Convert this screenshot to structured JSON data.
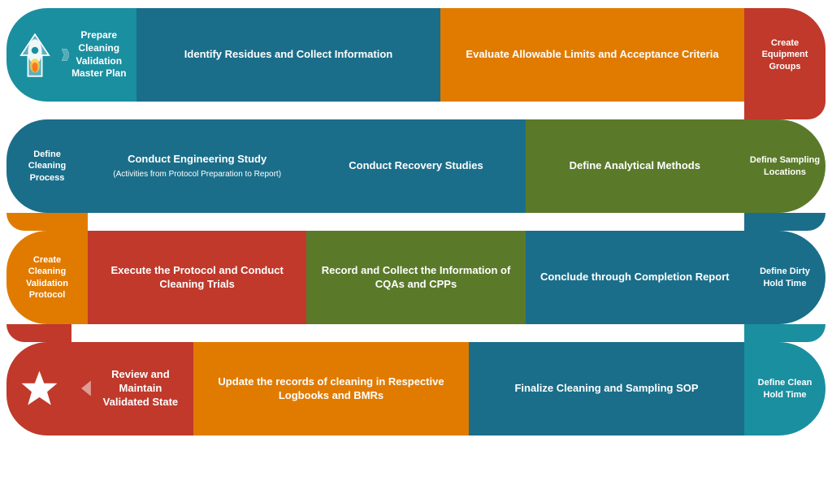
{
  "row1": {
    "launch_title": "Prepare Cleaning Validation Master Plan",
    "identify": "Identify Residues and Collect Information",
    "evaluate": "Evaluate Allowable Limits and Acceptance Criteria",
    "equipment": "Create Equipment Groups"
  },
  "row2": {
    "define_cleaning": "Define Cleaning Process",
    "engineering": "Conduct Engineering Study",
    "engineering_sub": "(Activities from Protocol Preparation to Report)",
    "recovery": "Conduct Recovery Studies",
    "analytical": "Define Analytical Methods",
    "sampling": "Define Sampling Locations"
  },
  "row3": {
    "create_protocol": "Create Cleaning Validation Protocol",
    "execute": "Execute the Protocol and Conduct Cleaning Trials",
    "record": "Record and Collect the Information of CQAs and CPPs",
    "conclude": "Conclude through Completion Report",
    "dirty_hold": "Define Dirty Hold Time"
  },
  "row4": {
    "review": "Review and Maintain Validated State",
    "update": "Update the records of cleaning in Respective Logbooks and BMRs",
    "finalize": "Finalize Cleaning and Sampling SOP",
    "clean_hold": "Define Clean Hold Time"
  }
}
